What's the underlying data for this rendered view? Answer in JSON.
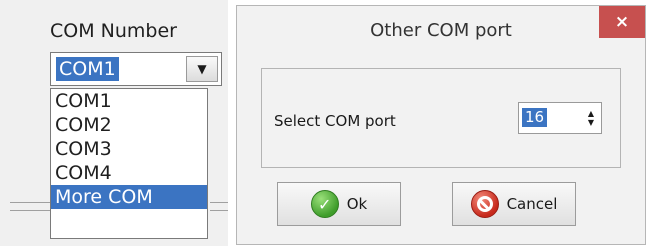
{
  "com_selector": {
    "label": "COM Number",
    "selected_value": "COM1",
    "dropdown_arrow": "chevron-down-icon",
    "options": [
      "COM1",
      "COM2",
      "COM3",
      "COM4",
      "More COM"
    ],
    "highlighted_option": "More COM"
  },
  "dialog": {
    "title": "Other COM port",
    "close_label": "×",
    "select_label": "Select COM port",
    "port_value": "16",
    "ok_label": "Ok",
    "cancel_label": "Cancel"
  },
  "colors": {
    "selection": "#3b74c2",
    "close_button": "#c7504f",
    "ok_icon": "#3f9d2b",
    "cancel_icon": "#c7291c"
  }
}
